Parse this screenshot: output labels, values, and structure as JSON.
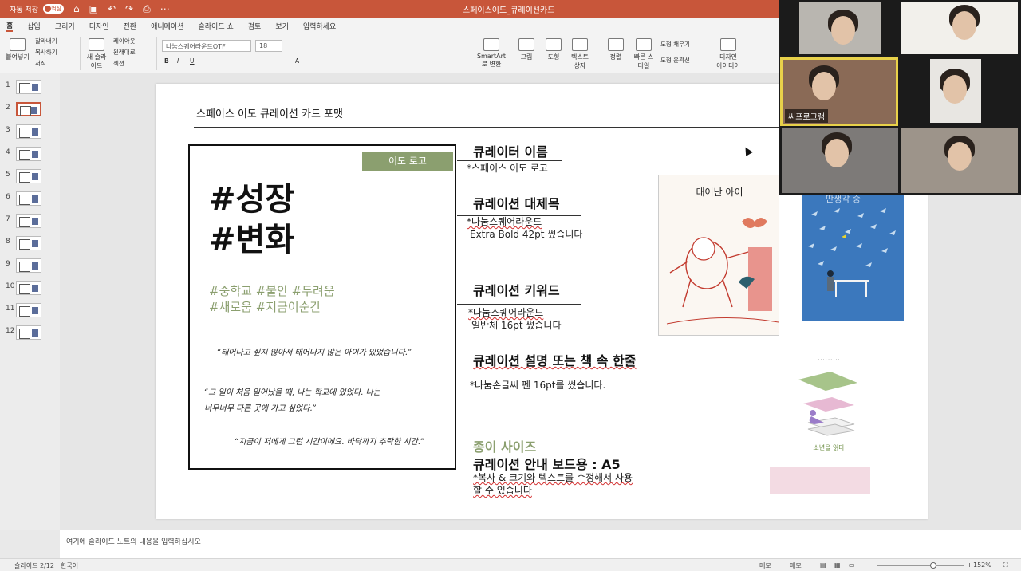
{
  "titlebar": {
    "autosave": "자동 저장",
    "autosave_state": "켜짐",
    "doc_title": "스페이스이도_큐레이션카드",
    "bg_color": "#c8563a"
  },
  "ribbon_tabs": [
    "홈",
    "삽입",
    "그리기",
    "디자인",
    "전환",
    "애니메이션",
    "슬라이드 쇼",
    "검토",
    "보기",
    "입력하세요"
  ],
  "ribbon": {
    "paste": "붙여넣기",
    "cut": "잘라내기",
    "copy": "복사하기",
    "format": "서식",
    "new_slide": "새 슬라이드",
    "layout": "레이아웃",
    "reset": "원래대로",
    "section": "섹션",
    "font_name": "나눔스퀘어라운드OTF",
    "font_size": "18",
    "smartart": "SmartArt로 변환",
    "picture": "그림",
    "shape": "도형",
    "textbox": "텍스트 상자",
    "arrange": "정렬",
    "quick_style": "빠른 스타일",
    "shape_fill": "도형 채우기",
    "shape_outline": "도형 윤곽선",
    "designer": "디자인 아이디어"
  },
  "thumbnails": [
    "1",
    "2",
    "3",
    "4",
    "5",
    "6",
    "7",
    "8",
    "9",
    "10",
    "11",
    "12"
  ],
  "selected_slide": 2,
  "slide": {
    "title": "스페이스 이도 큐레이션 카드 포맷",
    "card": {
      "logo": "이도 로고",
      "hash_line1": "#성장",
      "hash_line2": "#변화",
      "keywords_line1": "#중학교 #불안 #두려움",
      "keywords_line2": "#새로움 #지금이순간",
      "quote1": "“태어나고 싶지 않아서 태어나지 않은 아이가 있었습니다.”",
      "quote2a": "“그 일이 처음 일어났을 때, 나는 학교에 있었다. 나는",
      "quote2b": "너무너무 다른 곳에 가고 싶었다.”",
      "quote3": "“지금이 저에게 그런 시간이에요. 바닥까지 추락한 시간.”"
    },
    "sec1_title": "큐레이터 이름",
    "sec1_note": "*스페이스 이도 로고",
    "sec2_title": "큐레이션 대제목",
    "sec2_note1": "*나눔스퀘어라운드",
    "sec2_note2": "Extra Bold 42pt 썼습니다",
    "sec3_title": "큐레이션 키워드",
    "sec3_note1": "*나눔스퀘어라운드",
    "sec3_note2": "일반체 16pt 썼습니다",
    "sec4_title": "큐레이션 설명 또는 책 속 한줄",
    "sec4_note": "*나눔손글씨 펜 16pt를 썼습니다.",
    "paper_title": "종이 사이즈",
    "paper_sub": "큐레이션 안내 보드용 : A5",
    "paper_note1": "*복사 & 크기와 텍스트를 수정해서 사용",
    "paper_note2": "할 수 있습니다",
    "book1_title": "태어난 아이",
    "book2_title": "딴생각 중",
    "book3_title": "소년을 읽다",
    "accent_green": "#8b9f6f"
  },
  "notes_placeholder": "여기에 슬라이드 노트의 내용을 입력하십시오",
  "status": {
    "slide_info": "슬라이드 2/12",
    "language": "한국어",
    "notes": "메모",
    "comments": "메모",
    "zoom": "152%"
  },
  "video": {
    "active_label": "씨프로그램"
  }
}
